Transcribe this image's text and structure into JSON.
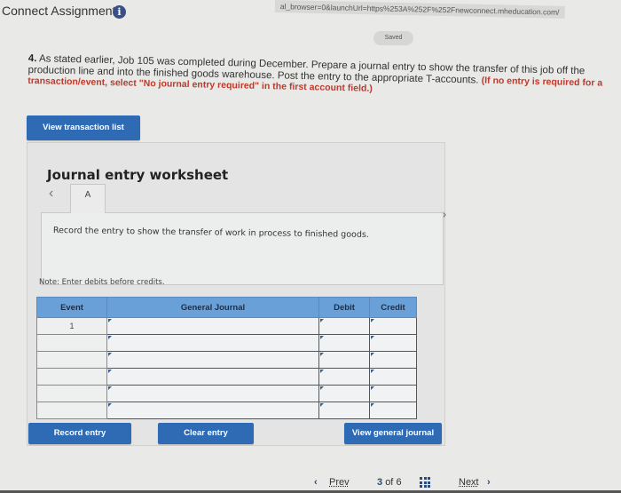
{
  "header": {
    "app_title": "Connect Assignment",
    "info_icon": "i",
    "url": "al_browser=0&launchUrl=https%253A%252F%252Fnewconnect.mheducation.com/",
    "saved_label": "Saved"
  },
  "question": {
    "number": "4.",
    "text": "As stated earlier, Job 105 was completed during December. Prepare a journal entry to show the transfer of this job off the production line and into the finished goods warehouse. Post the entry to the appropriate T-accounts.",
    "instruction": "(If no entry is required for a transaction/event, select \"No journal entry required\" in the first account field.)"
  },
  "buttons": {
    "view_transaction_list": "View transaction list",
    "record_entry": "Record entry",
    "clear_entry": "Clear entry",
    "view_general_journal": "View general journal"
  },
  "worksheet": {
    "title": "Journal entry worksheet",
    "prev_icon": "‹",
    "next_icon": "›",
    "active_tab": "A",
    "description": "Record the entry to show the transfer of work in process to finished goods.",
    "note": "Note: Enter debits before credits."
  },
  "journal": {
    "headers": {
      "event": "Event",
      "general_journal": "General Journal",
      "debit": "Debit",
      "credit": "Credit"
    },
    "rows": [
      {
        "event": "1",
        "account": "",
        "debit": "",
        "credit": ""
      },
      {
        "event": "",
        "account": "",
        "debit": "",
        "credit": ""
      },
      {
        "event": "",
        "account": "",
        "debit": "",
        "credit": ""
      },
      {
        "event": "",
        "account": "",
        "debit": "",
        "credit": ""
      },
      {
        "event": "",
        "account": "",
        "debit": "",
        "credit": ""
      },
      {
        "event": "",
        "account": "",
        "debit": "",
        "credit": ""
      }
    ]
  },
  "pager": {
    "prev_icon": "‹",
    "prev_label": "Prev",
    "current": "3",
    "of_label": "of",
    "total": "6",
    "next_label": "Next",
    "next_icon": "›"
  },
  "colors": {
    "accent": "#2e6bb4",
    "header_blue": "#6aa0d8",
    "instruction_red": "#c0392b"
  }
}
